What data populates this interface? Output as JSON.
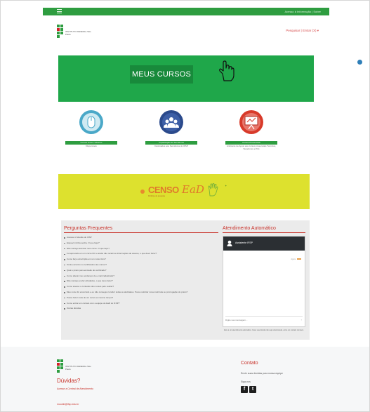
{
  "topbar": {
    "link": "Acesso à Informação | Sobre"
  },
  "header": {
    "logo_text": "INSTITUTO FEDERAL São Paulo",
    "user_link": "Pesquisar | Entrar (X) ▾"
  },
  "banner": {
    "label": "MEUS CURSOS",
    "color": "#1fa74a"
  },
  "links": [
    {
      "label": "Cursos Livres / Abertos",
      "desc": "Disponíveis",
      "icon": "mouse-icon",
      "color": "#4aa8c8"
    },
    {
      "label": "Capacitação de Servidores",
      "desc": "Destinados aos Servidores do IFSP",
      "icon": "group-icon",
      "color": "#2b4a8c"
    },
    {
      "label": "Cursos Presenciais",
      "desc": "Ambiente de Apoio aos cursos presenciais Técnicos, Superiores e Pós",
      "icon": "presentation-icon",
      "color": "#d83a2a"
    }
  ],
  "censo": {
    "word": "CENSO",
    "suffix": "EaD",
    "sub": "Participe da pesquisa",
    "color": "#dde12e"
  },
  "faq": {
    "title": "Perguntas Frequentes",
    "items": [
      "Acessar o Moodle do IFSP",
      "Esqueci minha senha. O que faço?",
      "Não consigo acessar meu curso. O que faço?",
      "Fui aprovado em um curso FIC e ainda não recebi as informações de acesso, o que devo fazer?",
      "Como faço a inscrição em um curso livre?",
      "Onde encontro os certificados dos cursos?",
      "Qual o prazo para emissão do certificado?",
      "Como alterar meu endereço de e-mail cadastrado?",
      "Não consigo enviar atividades, o que devo fazer?",
      "Como acesso o conteúdo dos cursos pelo celular?",
      "Meu curso foi encerrado e eu não consegui concluir todas as atividades. Posso solicitar nova matrícula ou prorrogação do prazo?",
      "Posso fazer mais de um curso ao mesmo tempo?",
      "Como entrar em contato com a equipe de EaD do IFSP?",
      "Outras dúvidas"
    ]
  },
  "chat": {
    "title": "Atendimento Automático",
    "bot_name": "Assistente IFSP",
    "time": "Agora",
    "placeholder": "Digite sua mensagem...",
    "note": "Este é um atendimento automático. Caso sua dúvida não seja solucionada, entre em contato conosco."
  },
  "footer": {
    "logo_text": "INSTITUTO FEDERAL São Paulo",
    "duvidas_title": "Dúvidas?",
    "duvidas_link": "Acesse a Central de Atendimento",
    "email": "moodle@ifsp.edu.br",
    "contato_title": "Contato",
    "contato_text": "Envie suas dúvidas para nossa equipe",
    "siga": "Siga-nos"
  }
}
